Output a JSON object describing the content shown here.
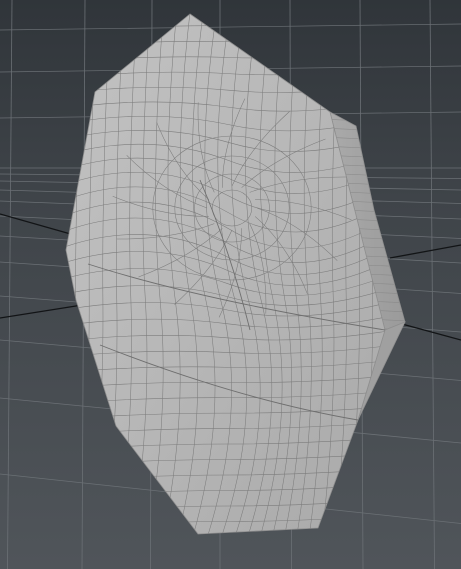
{
  "viewport": {
    "background_top": "#2f3438",
    "background_bottom": "#4f5459",
    "grid_color": "#6b7075",
    "axis_color": "#101214",
    "mesh_fill": "#b4b4b4",
    "mesh_side_fill": "#a3a3a3",
    "mesh_edge_color": "#7a7a7a"
  }
}
